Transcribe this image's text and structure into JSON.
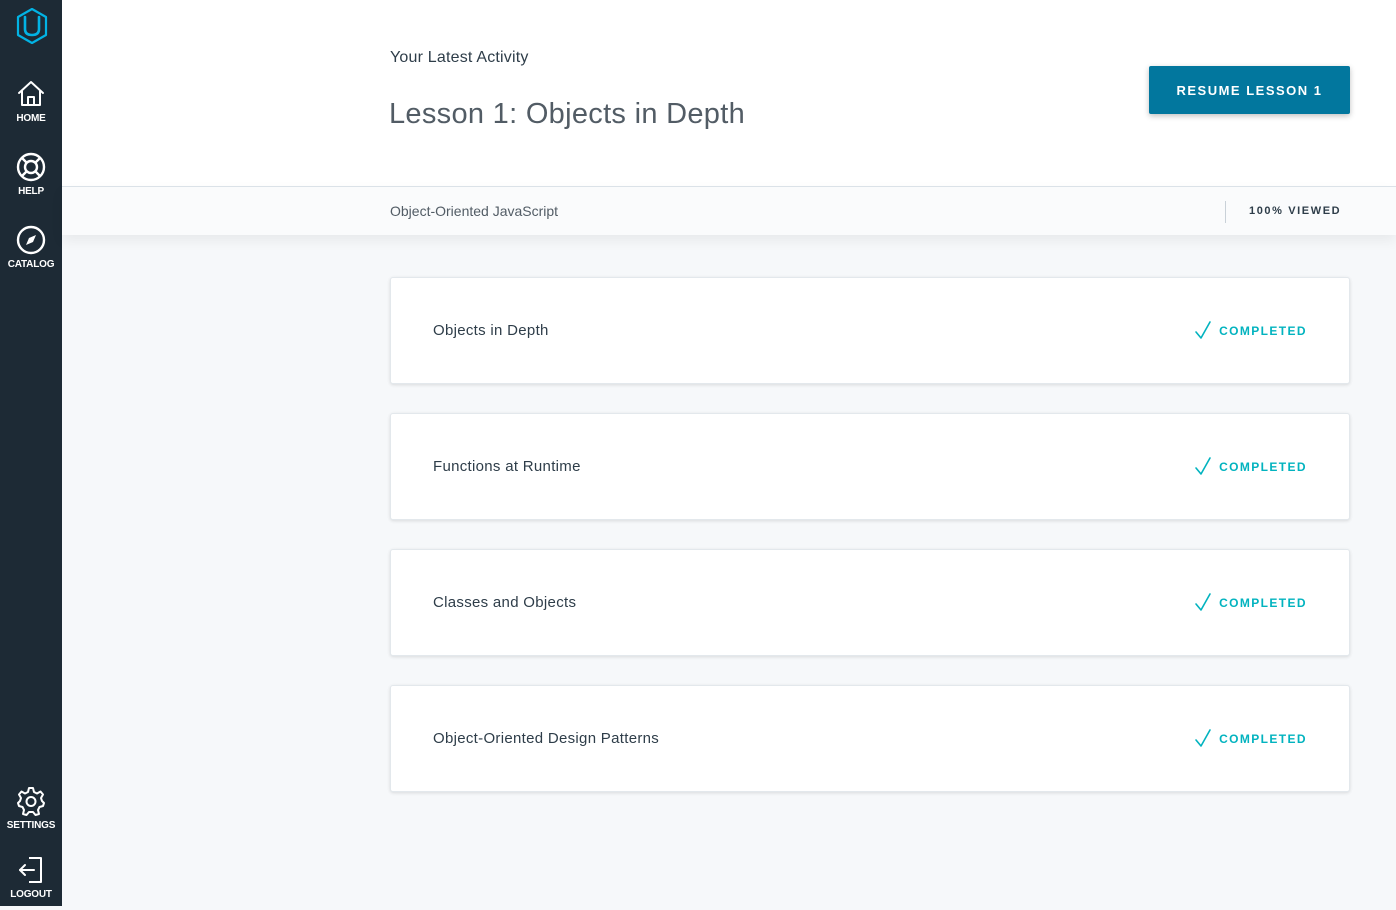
{
  "sidebar": {
    "logo_icon": "udacity-logo-icon",
    "items": [
      {
        "label": "HOME",
        "icon": "home-icon"
      },
      {
        "label": "HELP",
        "icon": "lifebuoy-icon"
      },
      {
        "label": "CATALOG",
        "icon": "compass-icon"
      },
      {
        "label": "SETTINGS",
        "icon": "gear-icon"
      },
      {
        "label": "LOGOUT",
        "icon": "logout-icon"
      }
    ]
  },
  "header": {
    "activity_label": "Your Latest Activity",
    "lesson_title": "Lesson 1: Objects in Depth",
    "resume_button": "RESUME LESSON 1"
  },
  "subbar": {
    "course_name": "Object-Oriented JavaScript",
    "viewed": "100% VIEWED"
  },
  "concepts": [
    {
      "title": "Objects in Depth",
      "status": "COMPLETED"
    },
    {
      "title": "Functions at Runtime",
      "status": "COMPLETED"
    },
    {
      "title": "Classes and Objects",
      "status": "COMPLETED"
    },
    {
      "title": "Object-Oriented Design Patterns",
      "status": "COMPLETED"
    }
  ],
  "colors": {
    "sidebar_bg": "#1d2a35",
    "accent_button": "#02779e",
    "completed": "#02b3bf",
    "page_bg": "#f6f8fa"
  }
}
